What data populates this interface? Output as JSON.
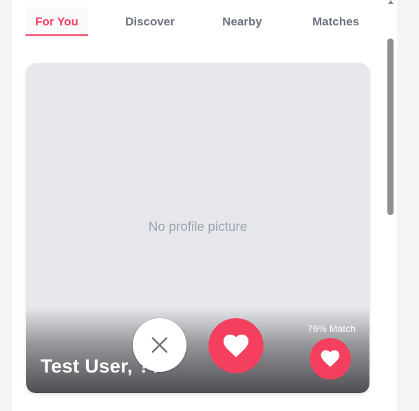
{
  "tabs": [
    {
      "label": "For You",
      "active": true
    },
    {
      "label": "Discover",
      "active": false
    },
    {
      "label": "Nearby",
      "active": false
    },
    {
      "label": "Matches",
      "active": false
    }
  ],
  "card": {
    "placeholder": "No profile picture",
    "name_age": "Test User, ??",
    "match_label": "76% Match",
    "match_percent": 76
  },
  "actions": {
    "dislike_icon": "close-icon",
    "like_icon": "heart-icon"
  },
  "colors": {
    "accent": "#f43f5e",
    "tab_inactive": "#6b7280",
    "card_bg": "#e5e7eb",
    "placeholder_text": "#9ca3af"
  }
}
